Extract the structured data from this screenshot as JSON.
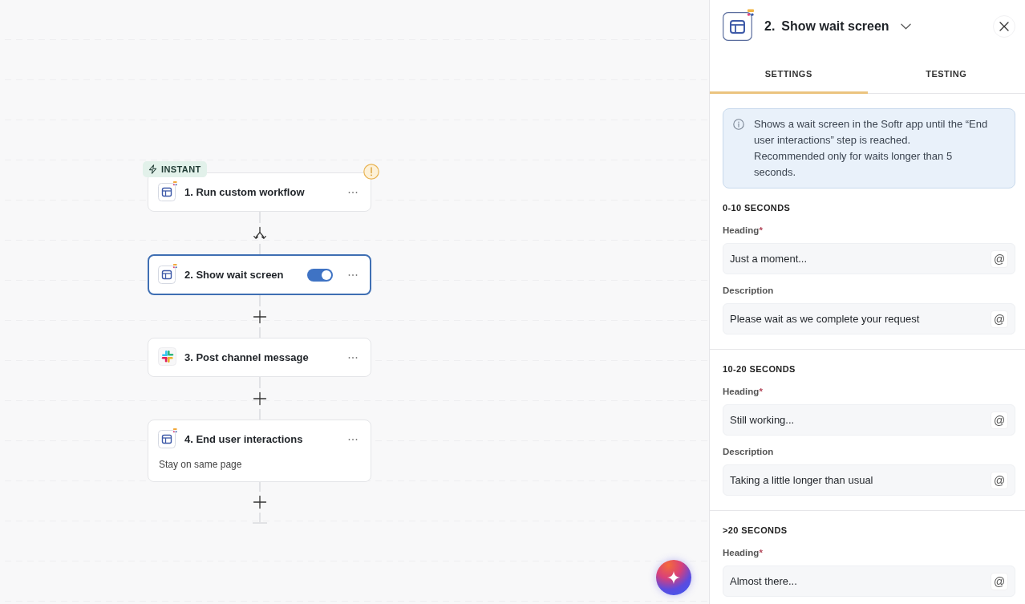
{
  "canvas": {
    "steps": [
      {
        "title": "1. Run custom workflow",
        "kind": "layout",
        "badge": "INSTANT",
        "warning": true,
        "selected": false
      },
      {
        "title": "2. Show wait screen",
        "kind": "layout",
        "warning": false,
        "selected": true,
        "toggle_on": true
      },
      {
        "title": "3. Post channel message",
        "kind": "chat",
        "warning": false,
        "selected": false
      },
      {
        "title": "4. End user interactions",
        "kind": "layout",
        "subtitle": "Stay on same page",
        "warning": false,
        "selected": false
      }
    ],
    "connectors": [
      {
        "kind": "branch"
      },
      {
        "kind": "add"
      },
      {
        "kind": "add"
      },
      {
        "kind": "add"
      }
    ]
  },
  "panel": {
    "step_number": "2.",
    "title": "Show wait screen",
    "tabs": [
      {
        "label": "SETTINGS",
        "selected": true
      },
      {
        "label": "TESTING",
        "selected": false
      }
    ],
    "info": [
      "Shows a wait screen in the Softr app until the “End user interactions” step is reached.",
      "Recommended only for waits longer than 5 seconds."
    ],
    "sections": [
      {
        "heading": "0-10 SECONDS",
        "fields": [
          {
            "label": "Heading",
            "required_mark": "*",
            "value": "Just a moment...",
            "button": "@"
          },
          {
            "label": "Description",
            "value": "Please wait as we complete your request",
            "button": "@"
          }
        ]
      },
      {
        "heading": "10-20 SECONDS",
        "fields": [
          {
            "label": "Heading",
            "required_mark": "*",
            "value": "Still working...",
            "button": "@"
          },
          {
            "label": "Description",
            "value": "Taking a little longer than usual",
            "button": "@"
          }
        ]
      },
      {
        "heading": ">20 SECONDS",
        "fields": [
          {
            "label": "Heading",
            "required_mark": "*",
            "value": "Almost there...",
            "button": "@"
          }
        ]
      }
    ]
  }
}
